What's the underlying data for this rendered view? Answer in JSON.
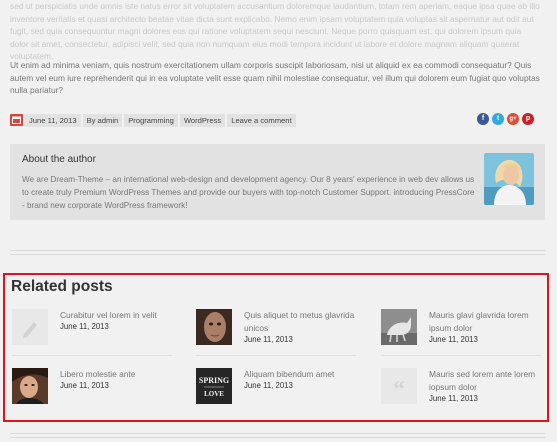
{
  "post": {
    "paragraph1": "sed ut perspiciatis unde omnis iste natus error sit voluptatem accusantium doloremque laudantium, totam rem aperiam, eaque ipsa quae ab illo inventore veritatis et quasi architecto beatae vitae dicta sunt explicabo. Nemo enim ipsam voluptatem quia voluptas sit aspernatur aut odit aut fugit, sed quia consequuntur magni dolores eos qui ratione voluptatem sequi nesciunt. Neque porro quisquam est, qui dolorem ipsum quia dolor sit amet, consectetur, adipisci velit, sed quia non numquam eius modi tempora incidunt ut labore et dolore magnam aliquam quaerat voluptatem.",
    "paragraph2": "Ut enim ad minima veniam, quis nostrum exercitationem ullam corporis suscipit laboriosam, nisi ut aliquid ex ea commodi consequatur? Quis autem vel eum iure reprehenderit qui in ea voluptate velit esse quam nihil molestiae consequatur, vel illum qui dolorem eum fugiat quo voluptas nulla pariatur?"
  },
  "meta": {
    "date": "June 11, 2013",
    "author": "By admin",
    "category1": "Programming",
    "category2": "WordPress",
    "comment": "Leave a comment"
  },
  "social": [
    {
      "icon": "facebook-icon",
      "glyph": "f",
      "color": "#3b5998"
    },
    {
      "icon": "twitter-icon",
      "glyph": "t",
      "color": "#2fa9e0"
    },
    {
      "icon": "googleplus-icon",
      "glyph": "g+",
      "color": "#dd4b39"
    },
    {
      "icon": "pinterest-icon",
      "glyph": "p",
      "color": "#cb2027"
    }
  ],
  "author": {
    "title": "About the author",
    "bio": "We are Dream-Theme – an international web-design and development agency. Our 8 years' experience in web dev allows us to create truly Premium WordPress Themes and provide our buyers with top-notch Customer Support. introducing PressCore - brand new corporate WordPress framework!"
  },
  "related": {
    "heading": "Related posts",
    "items": [
      {
        "title": "Curabitur vel lorem in velit",
        "date": "June 11, 2013",
        "thumb": "pencil-icon"
      },
      {
        "title": "Quis aliquet to metus glavrida unicos",
        "date": "June 11, 2013",
        "thumb": "face-photo"
      },
      {
        "title": "Mauris glavi glavrida lorem ipsum dolor",
        "date": "June 11, 2013",
        "thumb": "horse-photo"
      },
      {
        "title": "Libero molestie ante",
        "date": "June 11, 2013",
        "thumb": "woman-photo"
      },
      {
        "title": "Aliquam bibendum amet",
        "date": "June 11, 2013",
        "thumb": "spring-love-image"
      },
      {
        "title": "Mauris sed lorem ante lorem iopsum dolor",
        "date": "June 11, 2013",
        "thumb": "quote-icon"
      }
    ],
    "spring_text1": "SPRING",
    "spring_text2": "LOVE"
  }
}
